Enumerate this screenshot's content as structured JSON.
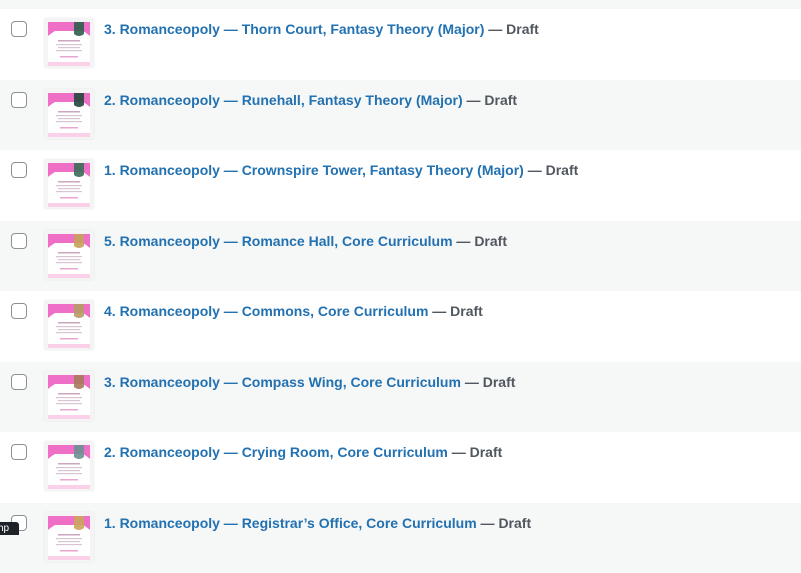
{
  "posts": [
    {
      "title": "3. Romanceopoly — Thorn Court, Fantasy Theory (Major)",
      "separator": " — ",
      "state": "Draft",
      "thumbnail": "card-thumbnail-icon",
      "accent": "#2e5e4e"
    },
    {
      "title": "2. Romanceopoly — Runehall, Fantasy Theory (Major)",
      "separator": " — ",
      "state": "Draft",
      "thumbnail": "card-thumbnail-icon",
      "accent": "#24463c"
    },
    {
      "title": "1. Romanceopoly — Crownspire Tower, Fantasy Theory (Major)",
      "separator": " — ",
      "state": "Draft",
      "thumbnail": "card-thumbnail-icon",
      "accent": "#3b6d58"
    },
    {
      "title": "5. Romanceopoly — Romance Hall, Core Curriculum",
      "separator": " — ",
      "state": "Draft",
      "thumbnail": "card-thumbnail-icon",
      "accent": "#c7a15a"
    },
    {
      "title": "4. Romanceopoly — Commons, Core Curriculum",
      "separator": " — ",
      "state": "Draft",
      "thumbnail": "card-thumbnail-icon",
      "accent": "#b59b63"
    },
    {
      "title": "3. Romanceopoly — Compass Wing, Core Curriculum",
      "separator": " — ",
      "state": "Draft",
      "thumbnail": "card-thumbnail-icon",
      "accent": "#a8795c"
    },
    {
      "title": "2. Romanceopoly — Crying Room, Core Curriculum",
      "separator": " — ",
      "state": "Draft",
      "thumbnail": "card-thumbnail-icon",
      "accent": "#6b8f93"
    },
    {
      "title": "1. Romanceopoly — Registrar’s Office, Core Curriculum",
      "separator": " — ",
      "state": "Draft",
      "thumbnail": "card-thumbnail-icon",
      "accent": "#caa45b"
    }
  ],
  "tooltip": {
    "text": "hp"
  },
  "colors": {
    "link": "#2271b1",
    "state": "#50575e",
    "row_alt": "#f6f7f7",
    "thumb_pink": "#f06fc6"
  }
}
